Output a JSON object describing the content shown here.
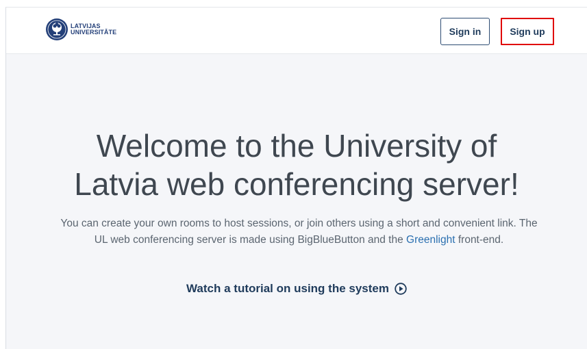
{
  "header": {
    "logo": {
      "line1": "LATVIJAS",
      "line2": "UNIVERSITĀTE"
    },
    "signin_label": "Sign in",
    "signup_label": "Sign up"
  },
  "hero": {
    "title_line1": "Welcome to the University of",
    "title_line2": "Latvia web conferencing server!",
    "desc_part1": "You can create your own rooms to host sessions, or join others using a short and convenient link. The UL web conferencing server is made using BigBlueButton and the ",
    "desc_link": "Greenlight",
    "desc_part2": " front-end.",
    "tutorial_label": "Watch a tutorial on using the system"
  },
  "icons": [
    "latvijas-universitate-logo",
    "play-circle-icon"
  ],
  "colors": {
    "primary": "#1f3b5b",
    "link": "#2a6fb0",
    "highlight": "#e00000",
    "background": "#f5f6f9"
  }
}
